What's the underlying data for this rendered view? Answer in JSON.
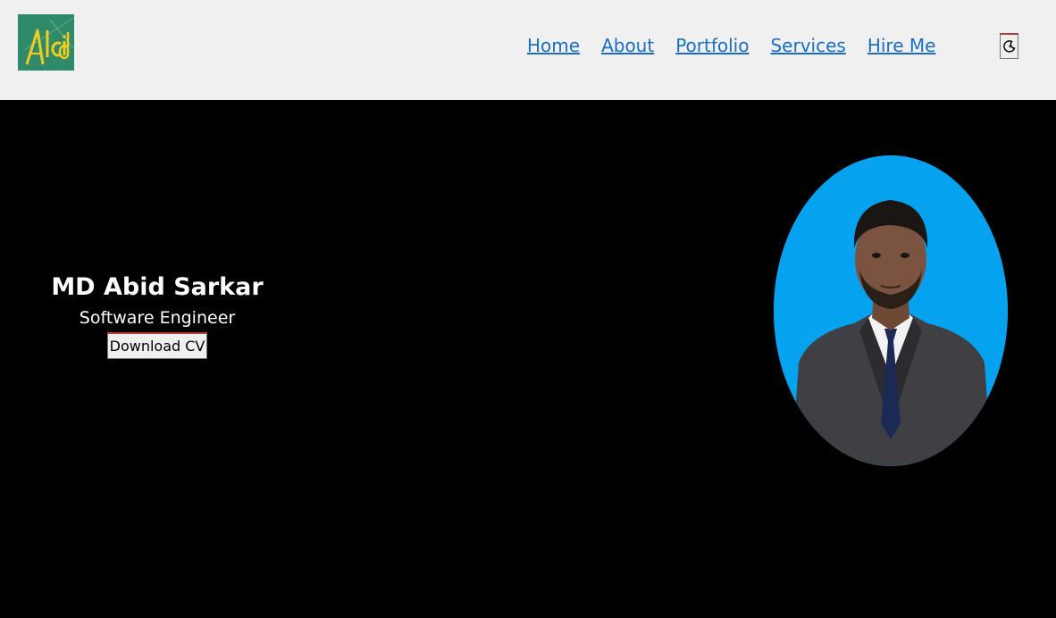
{
  "logo": {
    "text": "Alcid",
    "bg_color": "#2f8a6a",
    "text_color": "#f2cc1f"
  },
  "nav": {
    "items": [
      {
        "label": "Home"
      },
      {
        "label": "About"
      },
      {
        "label": "Portfolio"
      },
      {
        "label": "Services"
      },
      {
        "label": "Hire Me"
      }
    ],
    "link_color": "#1a6fc4"
  },
  "theme_toggle": {
    "icon": "moon-icon"
  },
  "hero": {
    "name": "MD Abid Sarkar",
    "role": "Software Engineer",
    "cta_label": "Download CV",
    "bg_color": "#000000",
    "portrait_bg_color": "#05a3ef"
  }
}
